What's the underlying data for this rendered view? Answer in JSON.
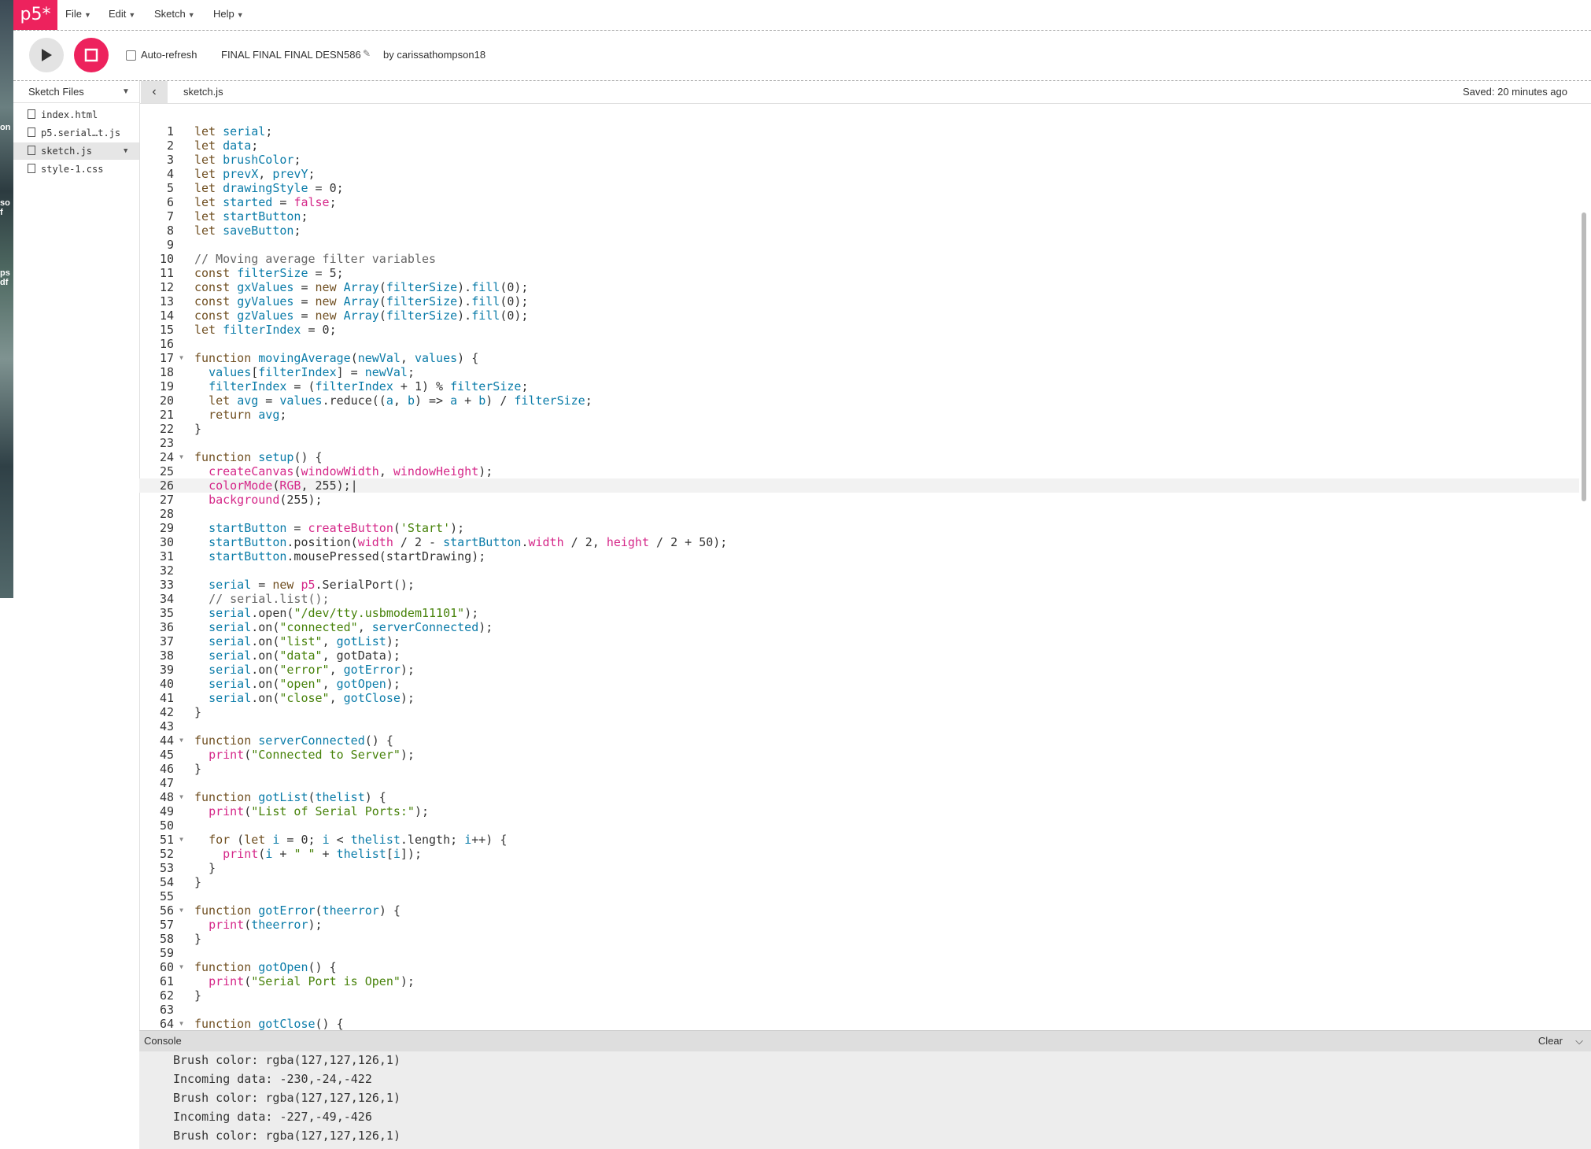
{
  "nav": {
    "logo": "p5*",
    "menus": [
      "File",
      "Edit",
      "Sketch",
      "Help"
    ]
  },
  "toolbar": {
    "autorefresh_label": "Auto-refresh",
    "sketch_name": "FINAL FINAL FINAL DESN586",
    "owner": "by carissathompson18"
  },
  "sidebar": {
    "title": "Sketch Files",
    "files": [
      "index.html",
      "p5.serial…t.js",
      "sketch.js",
      "style-1.css"
    ],
    "active_file": "sketch.js"
  },
  "editor": {
    "tab": "sketch.js",
    "saved": "Saved: 20 minutes ago",
    "current_line": 26,
    "fold_lines": [
      17,
      24,
      44,
      48,
      51,
      56,
      60,
      64
    ],
    "lines": [
      "let serial;",
      "let data;",
      "let brushColor;",
      "let prevX, prevY;",
      "let drawingStyle = 0;",
      "let started = false;",
      "let startButton;",
      "let saveButton;",
      "",
      "// Moving average filter variables",
      "const filterSize = 5;",
      "const gxValues = new Array(filterSize).fill(0);",
      "const gyValues = new Array(filterSize).fill(0);",
      "const gzValues = new Array(filterSize).fill(0);",
      "let filterIndex = 0;",
      "",
      "function movingAverage(newVal, values) {",
      "  values[filterIndex] = newVal;",
      "  filterIndex = (filterIndex + 1) % filterSize;",
      "  let avg = values.reduce((a, b) => a + b) / filterSize;",
      "  return avg;",
      "}",
      "",
      "function setup() {",
      "  createCanvas(windowWidth, windowHeight);",
      "  colorMode(RGB, 255);|",
      "  background(255);",
      "",
      "  startButton = createButton('Start');",
      "  startButton.position(width / 2 - startButton.width / 2, height / 2 + 50);",
      "  startButton.mousePressed(startDrawing);",
      "",
      "  serial = new p5.SerialPort();",
      "  // serial.list();",
      "  serial.open(\"/dev/tty.usbmodem11101\");",
      "  serial.on(\"connected\", serverConnected);",
      "  serial.on(\"list\", gotList);",
      "  serial.on(\"data\", gotData);",
      "  serial.on(\"error\", gotError);",
      "  serial.on(\"open\", gotOpen);",
      "  serial.on(\"close\", gotClose);",
      "}",
      "",
      "function serverConnected() {",
      "  print(\"Connected to Server\");",
      "}",
      "",
      "function gotList(thelist) {",
      "  print(\"List of Serial Ports:\");",
      "",
      "  for (let i = 0; i < thelist.length; i++) {",
      "    print(i + \" \" + thelist[i]);",
      "  }",
      "}",
      "",
      "function gotError(theerror) {",
      "  print(theerror);",
      "}",
      "",
      "function gotOpen() {",
      "  print(\"Serial Port is Open\");",
      "}",
      "",
      "function gotClose() {"
    ]
  },
  "console": {
    "title": "Console",
    "clear_label": "Clear",
    "messages": [
      "Brush color: rgba(127,127,126,1)",
      "Incoming data: -230,-24,-422",
      "Brush color: rgba(127,127,126,1)",
      "Incoming data: -227,-49,-426",
      "Brush color: rgba(127,127,126,1)"
    ]
  },
  "background_fragments": [
    "on",
    "so",
    "f",
    "ps",
    "df"
  ],
  "colors": {
    "accent": "#ed225d",
    "keyword": "#704f21",
    "def": "#0b7ca9",
    "builtin": "#d52889",
    "string": "#47820a",
    "comment": "#666666",
    "number": "#333333"
  }
}
